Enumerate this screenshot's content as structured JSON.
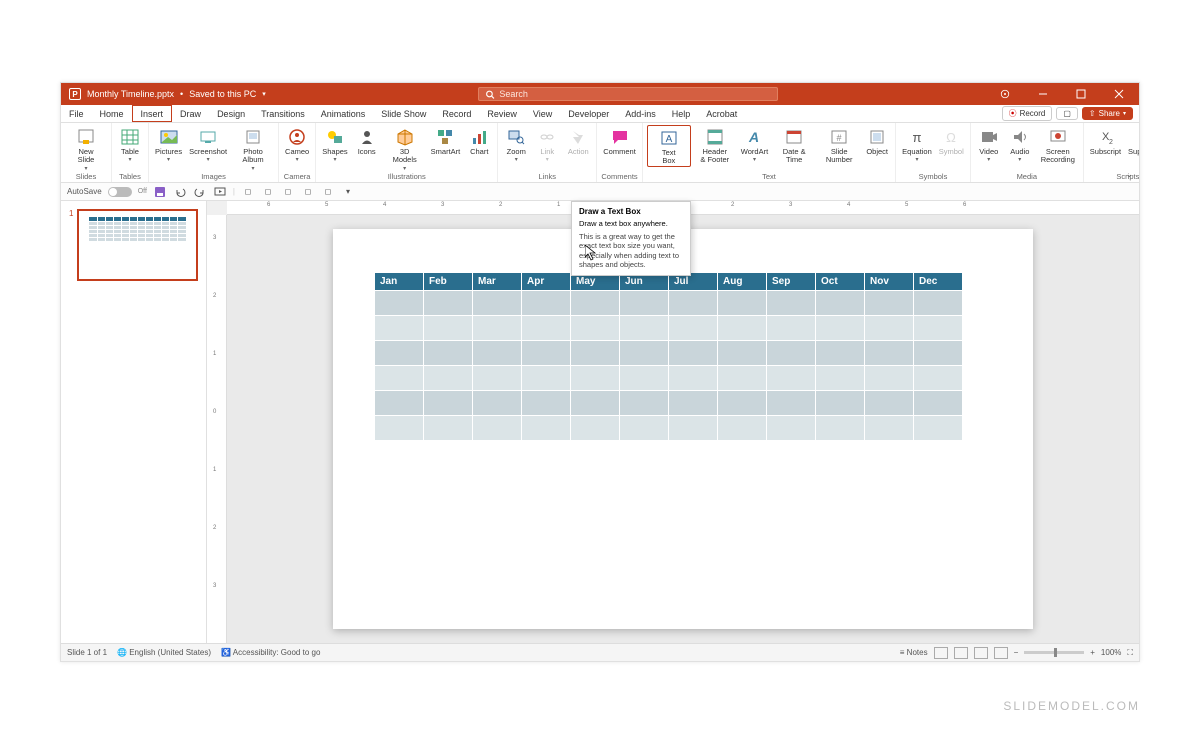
{
  "title": {
    "filename": "Monthly Timeline.pptx",
    "saved": "Saved to this PC"
  },
  "search_placeholder": "Search",
  "tabs": [
    "File",
    "Home",
    "Insert",
    "Draw",
    "Design",
    "Transitions",
    "Animations",
    "Slide Show",
    "Record",
    "Review",
    "View",
    "Developer",
    "Add-ins",
    "Help",
    "Acrobat"
  ],
  "tabs_right": {
    "record": "Record",
    "share": "Share"
  },
  "ribbon": {
    "slides": {
      "label": "Slides",
      "new_slide": "New\nSlide"
    },
    "tables": {
      "label": "Tables",
      "table": "Table"
    },
    "images": {
      "label": "Images",
      "pictures": "Pictures",
      "screenshot": "Screenshot",
      "photo_album": "Photo\nAlbum"
    },
    "camera": {
      "label": "Camera",
      "cameo": "Cameo"
    },
    "illus": {
      "label": "Illustrations",
      "shapes": "Shapes",
      "icons": "Icons",
      "models": "3D\nModels",
      "smartart": "SmartArt",
      "chart": "Chart"
    },
    "links": {
      "label": "Links",
      "zoom": "Zoom",
      "link": "Link",
      "action": "Action"
    },
    "comments": {
      "label": "Comments",
      "comment": "Comment"
    },
    "text": {
      "label": "Text",
      "textbox": "Text\nBox",
      "header": "Header\n& Footer",
      "wordart": "WordArt",
      "datetime": "Date &\nTime",
      "slidenum": "Slide\nNumber",
      "object": "Object"
    },
    "symbols": {
      "label": "Symbols",
      "equation": "Equation",
      "symbol": "Symbol"
    },
    "media": {
      "label": "Media",
      "video": "Video",
      "audio": "Audio",
      "screen": "Screen\nRecording"
    },
    "scripts": {
      "label": "Scripts",
      "sub": "Subscript",
      "sup": "Superscript"
    }
  },
  "qat": {
    "autosave": "AutoSave",
    "off": "Off"
  },
  "tooltip": {
    "title": "Draw a Text Box",
    "sub": "Draw a text box anywhere.",
    "body": "This is a great way to get the exact text box size you want, especially when adding text to shapes and objects."
  },
  "ruler_h": [
    "6",
    "5",
    "4",
    "3",
    "2",
    "1",
    "0",
    "1",
    "2",
    "3",
    "4",
    "5",
    "6"
  ],
  "ruler_v": [
    "3",
    "2",
    "1",
    "0",
    "1",
    "2",
    "3"
  ],
  "months": [
    "Jan",
    "Feb",
    "Mar",
    "Apr",
    "May",
    "Jun",
    "Jul",
    "Aug",
    "Sep",
    "Oct",
    "Nov",
    "Dec"
  ],
  "status": {
    "slide": "Slide 1 of 1",
    "lang": "English (United States)",
    "access": "Accessibility: Good to go",
    "notes": "Notes",
    "zoom": "100%"
  },
  "thumb_num": "1",
  "watermark": "SLIDEMODEL.COM"
}
